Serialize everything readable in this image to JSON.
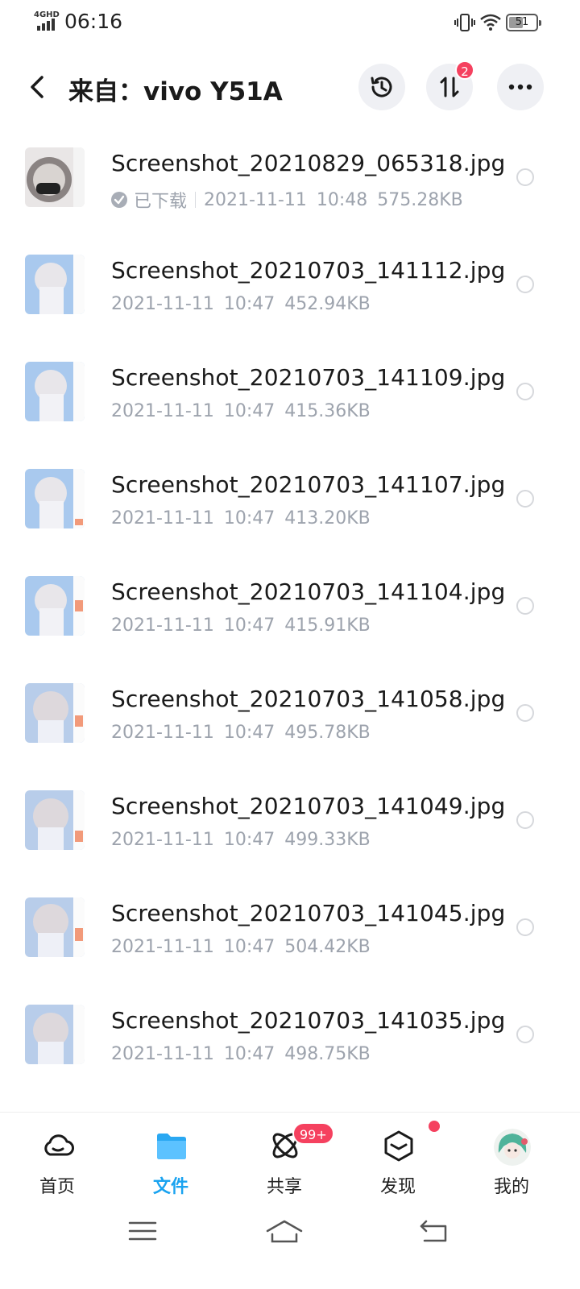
{
  "status_bar": {
    "network": "4GHD",
    "time": "06:16",
    "battery": "51",
    "icons": [
      "signal-icon",
      "vibrate-icon",
      "wifi-icon",
      "battery-icon"
    ]
  },
  "header": {
    "title": "来自：vivo Y51A",
    "transfer_badge": "2",
    "icons": [
      "back-icon",
      "history-icon",
      "transfer-icon",
      "more-icon"
    ]
  },
  "files": [
    {
      "name": "Screenshot_20210829_065318.jpg",
      "status": "已下载",
      "date": "2021-11-11",
      "time": "10:48",
      "size": "575.28KB"
    },
    {
      "name": "Screenshot_20210703_141112.jpg",
      "status": "",
      "date": "2021-11-11",
      "time": "10:47",
      "size": "452.94KB"
    },
    {
      "name": "Screenshot_20210703_141109.jpg",
      "status": "",
      "date": "2021-11-11",
      "time": "10:47",
      "size": "415.36KB"
    },
    {
      "name": "Screenshot_20210703_141107.jpg",
      "status": "",
      "date": "2021-11-11",
      "time": "10:47",
      "size": "413.20KB"
    },
    {
      "name": "Screenshot_20210703_141104.jpg",
      "status": "",
      "date": "2021-11-11",
      "time": "10:47",
      "size": "415.91KB"
    },
    {
      "name": "Screenshot_20210703_141058.jpg",
      "status": "",
      "date": "2021-11-11",
      "time": "10:47",
      "size": "495.78KB"
    },
    {
      "name": "Screenshot_20210703_141049.jpg",
      "status": "",
      "date": "2021-11-11",
      "time": "10:47",
      "size": "499.33KB"
    },
    {
      "name": "Screenshot_20210703_141045.jpg",
      "status": "",
      "date": "2021-11-11",
      "time": "10:47",
      "size": "504.42KB"
    },
    {
      "name": "Screenshot_20210703_141035.jpg",
      "status": "",
      "date": "2021-11-11",
      "time": "10:47",
      "size": "498.75KB"
    }
  ],
  "tabs": [
    {
      "label": "首页",
      "icon": "cloud-icon"
    },
    {
      "label": "文件",
      "icon": "folder-icon",
      "active": true
    },
    {
      "label": "共享",
      "icon": "share-atom-icon",
      "badge": "99+"
    },
    {
      "label": "发现",
      "icon": "discover-box-icon",
      "dot": true
    },
    {
      "label": "我的",
      "icon": "avatar"
    }
  ],
  "colors": {
    "accent": "#1aa3f0",
    "badge": "#f5415f",
    "meta_text": "#9da3ad",
    "header_button_bg": "#eff0f4"
  },
  "system_nav": [
    "menu-icon",
    "home-icon",
    "back-nav-icon"
  ]
}
